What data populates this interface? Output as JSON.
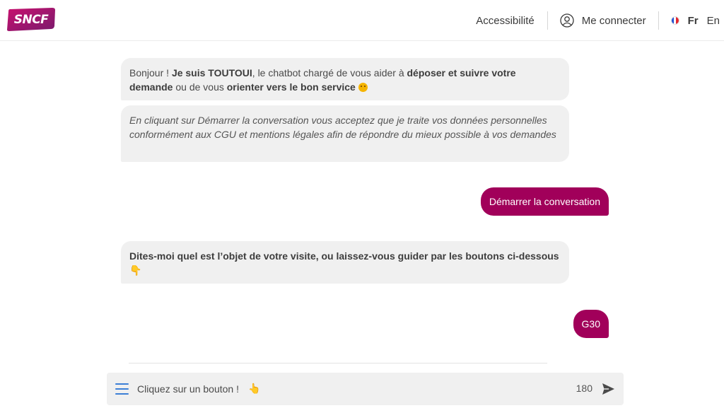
{
  "header": {
    "logo_text": "SNCF",
    "brand_color": "#a1005a",
    "accessibility_label": "Accessibilité",
    "login_label": "Me connecter",
    "lang_fr": "Fr",
    "lang_en": "En",
    "icons": [
      "user-icon",
      "flag-fr-icon"
    ]
  },
  "chat": {
    "messages": [
      {
        "from": "bot",
        "parts": [
          {
            "t": "Bonjour ! ",
            "b": false
          },
          {
            "t": "Je suis TOUTOUI",
            "b": true
          },
          {
            "t": ", le chatbot chargé de vous aider à ",
            "b": false
          },
          {
            "t": "déposer et suivre votre demande",
            "b": true
          },
          {
            "t": " ou de vous ",
            "b": false
          },
          {
            "t": "orienter vers le bon service",
            "b": true
          }
        ],
        "emoji": "smile-emoji-icon"
      },
      {
        "from": "bot",
        "italic": true,
        "text": "En cliquant sur Démarrer la conversation vous acceptez que je traite vos données personnelles conformément aux CGU et mentions légales afin de répondre du mieux possible à vos demandes"
      },
      {
        "from": "user",
        "text": "Démarrer la conversation"
      },
      {
        "from": "bot",
        "bold": true,
        "text": "Dites-moi quel est l’objet de votre visite, ou laissez-vous guider par les boutons ci-dessous",
        "emoji": "hand-down-icon"
      },
      {
        "from": "user",
        "text": "G30"
      }
    ]
  },
  "input": {
    "placeholder": "Cliquez sur un bouton !",
    "emoji": "hand-up-icon",
    "char_count": "180",
    "send_icon": "send-icon",
    "menu_icon": "menu-icon"
  },
  "colors": {
    "user_bubble": "#a1005a",
    "bot_bubble": "#f0f0f0",
    "menu_icon": "#3c7fd6"
  }
}
